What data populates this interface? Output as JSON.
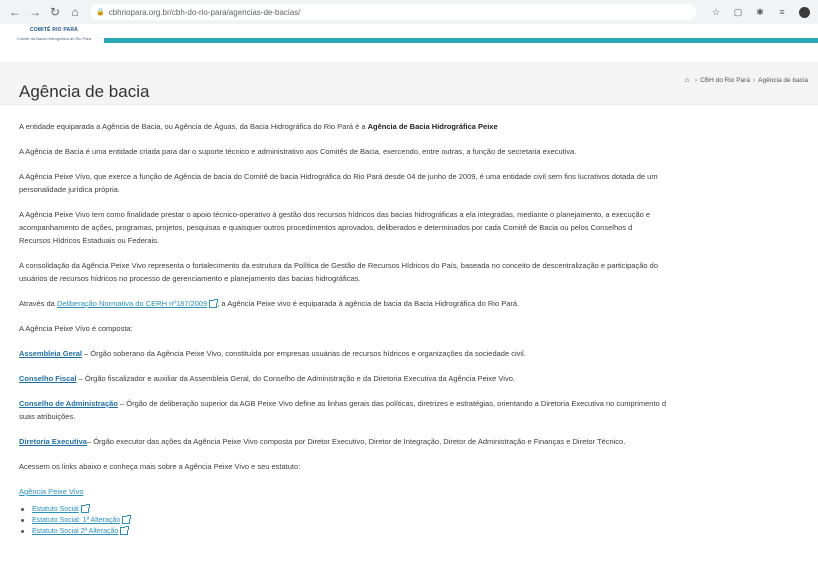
{
  "browser": {
    "url": "cbhriopara.org.br/cbh-do-rio-para/agencias-de-bacias/"
  },
  "site": {
    "logo_title": "COMITÊ RIO PARÁ",
    "logo_subtitle": "Comitê da Bacia Hidrográfica do Rio Pará",
    "accent_color": "#2aa6b5"
  },
  "page": {
    "title": "Agência de bacia",
    "breadcrumb": [
      "CBH do Rio Pará",
      "Agência de bacia"
    ]
  },
  "content": {
    "p1_text": "A entidade equiparada a Agência de Bacia, ou Agência de Águas, da Bacia Hidrográfica do Rio Pará é a ",
    "p1_bold": "Agência de Bacia Hidrográfica Peixe",
    "p2": "A Agência de Bacia é uma entidade criada para dar o suporte técnico e administrativo aos Comitês de Bacia, exercendo, entre outras, a função de secretaria executiva.",
    "p3_line1": "A Agência Peixe Vivo, que  exerce a função de Agência de bacia do Comitê de bacia Hidrográfica do Rio Pará desde 04 de junho de 2009, é uma entidade civil sem fins lucrativos dotada de um",
    "p3_line2": "personalidade jurídica própria.",
    "p4_line1": "A Agência Peixe Vivo tem como finalidade prestar o apoio técnico-operativo à gestão dos recursos hídricos das bacias hidrográficas a ela integradas, mediante o planejamento, a execução e",
    "p4_line2": "acompanhamento de ações, programas, projetos, pesquisas e quaisquer outros procedimentos aprovados, deliberados e determinados por cada Comitê de Bacia ou pelos Conselhos d",
    "p4_line3": "Recursos Hídricos Estaduais ou Federais.",
    "p5_line1": "A consolidação da Agência Peixe Vivo representa o fortalecimento da estrutura da Política de Gestão de Recursos Hídricos do País, baseada no conceito de descentralização e participação do",
    "p5_line2": "usuários de recursos hídricos no processo de gerenciamento e planejamento das bacias hidrográficas.",
    "p6_before": "Através da ",
    "p6_link": "Deliberação Normativa do CERH nº187/2009",
    "p6_after": ", a Agência Peixe vivo é equiparada à agência de bacia da Bacia Hidrográfica do Rio Pará.",
    "p7": "A Agência Peixe Vivo é composta:",
    "b1_link": "Assembleia Geral",
    "b1_text": " – Órgão soberano da Agência Peixe Vivo, constituída por empresas usuárias de recursos hídricos e organizações da sociedade civil.",
    "b2_link": "Conselho Fiscal",
    "b2_text": " – Órgão fiscalizador e auxiliar da Assembleia Geral, do Conselho de Administração e da Diretoria Executiva da Agência Peixe Vivo.",
    "b3_link": "Conselho de Administração",
    "b3_text_line1": " – Órgão de deliberação superior da AGB Peixe Vivo define as linhas gerais das políticas, diretrizes e estratégias, orientando a Diretoria Executiva no cumprimento d",
    "b3_text_line2": "suas atribuições.",
    "b4_link": "Diretoria Executiva",
    "b4_text": "– Órgão executor das ações da Agência Peixe Vivo composta por Diretor Executivo, Diretor de Integração, Diretor de Administração e Finanças e Diretor Técnico.",
    "p8": "Acessem os links abaixo e conheça mais sobre a Agência Peixe Vivo e seu estatuto:",
    "agency_link": "Agência Peixe Vivo",
    "docs": [
      "Estatuto Social",
      "Estatuto Social: 1ª Alteração",
      "Estatuto Social 2ª Alteração"
    ]
  }
}
